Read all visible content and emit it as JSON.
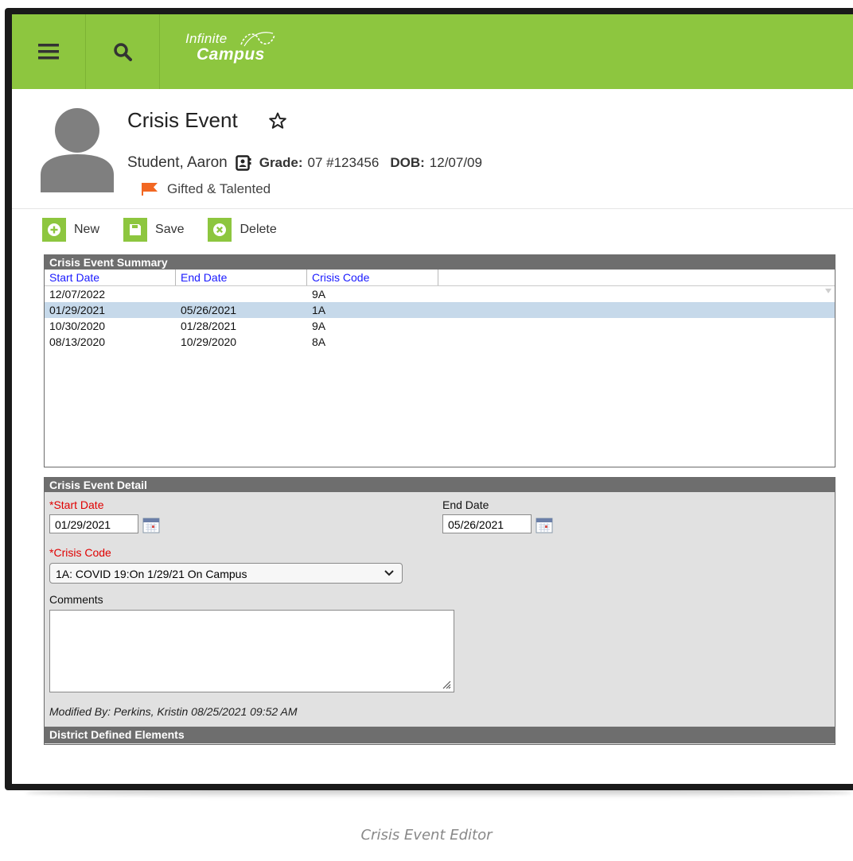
{
  "app": {
    "logo_line1": "Infinite",
    "logo_line2": "Campus"
  },
  "header": {
    "title": "Crisis Event",
    "student_name": "Student, Aaron",
    "grade_label": "Grade:",
    "grade_value": "07 #123456",
    "dob_label": "DOB:",
    "dob_value": "12/07/09",
    "flag_text": "Gifted & Talented",
    "flag_color": "#f26722"
  },
  "toolbar": {
    "new_label": "New",
    "save_label": "Save",
    "delete_label": "Delete",
    "accent": "#8dc63f"
  },
  "summary": {
    "title": "Crisis Event Summary",
    "columns": [
      "Start Date",
      "End Date",
      "Crisis Code"
    ],
    "rows": [
      {
        "start": "12/07/2022",
        "end": "",
        "code": "9A"
      },
      {
        "start": "01/29/2021",
        "end": "05/26/2021",
        "code": "1A"
      },
      {
        "start": "10/30/2020",
        "end": "01/28/2021",
        "code": "9A"
      },
      {
        "start": "08/13/2020",
        "end": "10/29/2020",
        "code": "8A"
      }
    ],
    "selected_row": 1
  },
  "detail": {
    "title": "Crisis Event Detail",
    "required_marker": "*",
    "start_label": "Start Date",
    "start_value": "01/29/2021",
    "end_label": "End Date",
    "end_value": "05/26/2021",
    "code_label": "Crisis Code",
    "code_value": "1A: COVID 19:On 1/29/21 On Campus",
    "comments_label": "Comments",
    "comments_value": "",
    "modified": "Modified By: Perkins, Kristin 08/25/2021 09:52 AM",
    "district_header": "District Defined Elements"
  },
  "caption": "Crisis Event Editor"
}
